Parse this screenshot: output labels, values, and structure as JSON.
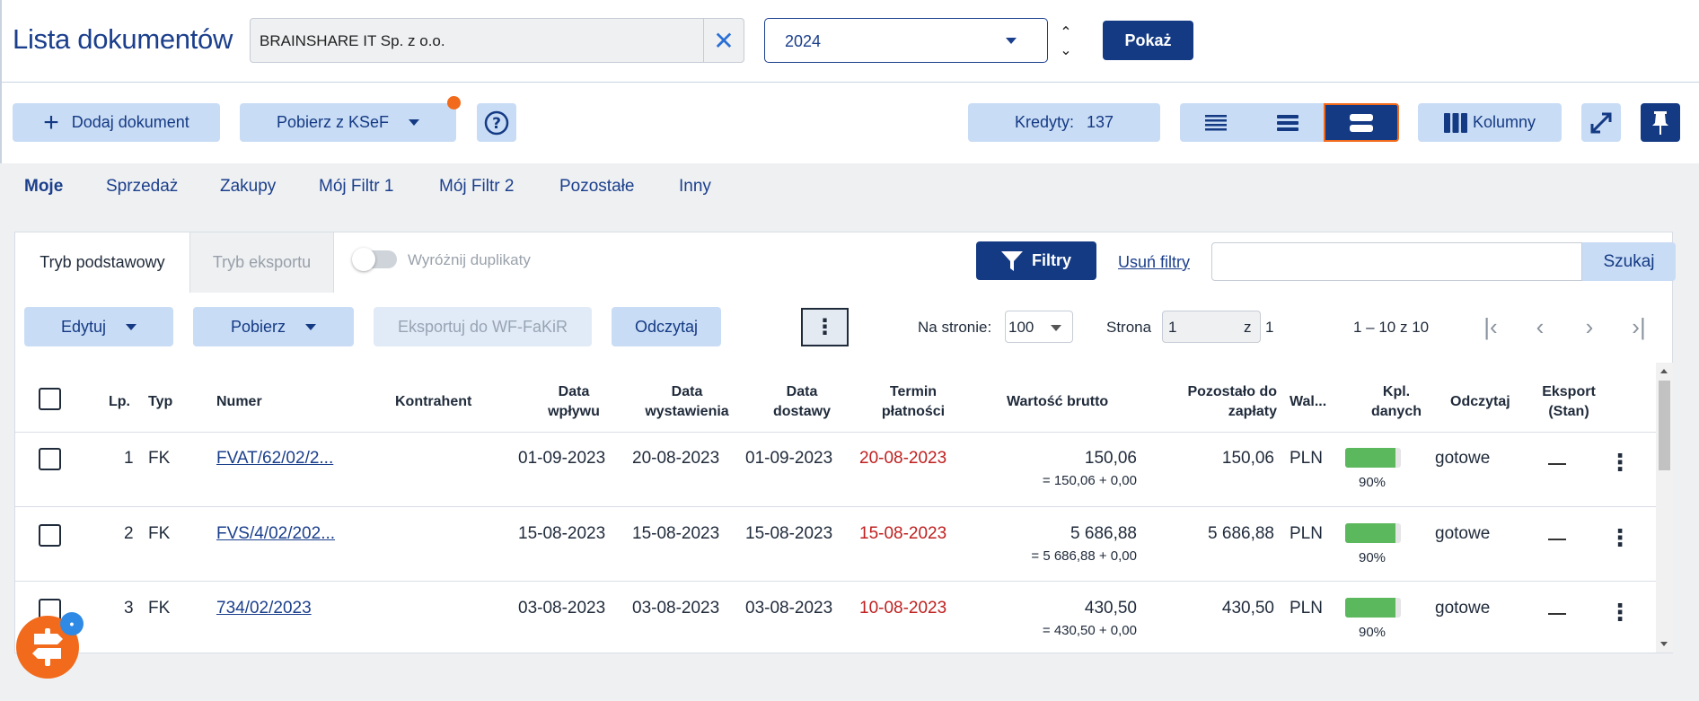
{
  "header": {
    "title": "Lista dokumentów",
    "company": "BRAINSHARE IT Sp. z o.o.",
    "year": "2024",
    "show_label": "Pokaż"
  },
  "toolbar": {
    "add_label": "Dodaj dokument",
    "ksef_label": "Pobierz z KSeF",
    "credits_label": "Kredyty:",
    "credits_value": "137",
    "columns_label": "Kolumny"
  },
  "filter_tabs": [
    "Moje",
    "Sprzedaż",
    "Zakupy",
    "Mój Filtr 1",
    "Mój Filtr 2",
    "Pozostałe",
    "Inny"
  ],
  "mode_tabs": {
    "basic": "Tryb podstawowy",
    "export": "Tryb eksportu",
    "duplicates_label": "Wyróżnij duplikaty"
  },
  "filters": {
    "filters_label": "Filtry",
    "clear_label": "Usuń filtry",
    "search_label": "Szukaj",
    "search_value": ""
  },
  "actions": {
    "edit_label": "Edytuj",
    "download_label": "Pobierz",
    "export_label": "Eksportuj do WF-FaKiR",
    "read_label": "Odczytaj"
  },
  "pager": {
    "per_page_label": "Na stronie:",
    "per_page_value": "100",
    "page_label": "Strona",
    "page_value": "1",
    "of_label": "z",
    "total_pages": "1",
    "range": "1 – 10 z 10"
  },
  "table": {
    "headers": {
      "lp": "Lp.",
      "typ": "Typ",
      "numer": "Numer",
      "kontrahent": "Kontrahent",
      "data_wplywu": [
        "Data",
        "wpływu"
      ],
      "data_wystawienia": [
        "Data",
        "wystawienia"
      ],
      "data_dostawy": [
        "Data",
        "dostawy"
      ],
      "termin": [
        "Termin",
        "płatności"
      ],
      "brutto": "Wartość brutto",
      "pozostalo": [
        "Pozostało do",
        "zapłaty"
      ],
      "waluta": "Wal...",
      "kpl": [
        "Kpl.",
        "danych"
      ],
      "odczytaj": "Odczytaj",
      "eksport": [
        "Eksport",
        "(Stan)"
      ]
    },
    "rows": [
      {
        "lp": "1",
        "typ": "FK",
        "numer": "FVAT/62/02/2...",
        "kontrahent": "",
        "data_wplywu": "01-09-2023",
        "data_wystawienia": "20-08-2023",
        "data_dostawy": "01-09-2023",
        "termin": "20-08-2023",
        "brutto": "150,06",
        "brutto_detail": "= 150,06 + 0,00",
        "pozostalo": "150,06",
        "waluta": "PLN",
        "kpl_pct": 90,
        "kpl_label": "90%",
        "odczytaj": "gotowe"
      },
      {
        "lp": "2",
        "typ": "FK",
        "numer": "FVS/4/02/202...",
        "kontrahent": "",
        "data_wplywu": "15-08-2023",
        "data_wystawienia": "15-08-2023",
        "data_dostawy": "15-08-2023",
        "termin": "15-08-2023",
        "brutto": "5 686,88",
        "brutto_detail": "= 5 686,88 + 0,00",
        "pozostalo": "5 686,88",
        "waluta": "PLN",
        "kpl_pct": 90,
        "kpl_label": "90%",
        "odczytaj": "gotowe"
      },
      {
        "lp": "3",
        "typ": "FK",
        "numer": "734/02/2023",
        "kontrahent": "",
        "data_wplywu": "03-08-2023",
        "data_wystawienia": "03-08-2023",
        "data_dostawy": "03-08-2023",
        "termin": "10-08-2023",
        "brutto": "430,50",
        "brutto_detail": "= 430,50 + 0,00",
        "pozostalo": "430,50",
        "waluta": "PLN",
        "kpl_pct": 90,
        "kpl_label": "90%",
        "odczytaj": "gotowe"
      }
    ]
  },
  "colors": {
    "primary": "#143a84",
    "accent_light": "#c9dcf5",
    "overdue": "#c01f1f",
    "progress": "#5cb85c",
    "fab": "#f26a1b"
  },
  "icons": {
    "clear": "close-icon",
    "add": "plus-icon",
    "help": "question-icon",
    "density_compact": "list-compact-icon",
    "density_normal": "list-normal-icon",
    "density_comfortable": "list-comfortable-icon",
    "columns": "columns-icon",
    "expand": "expand-icon",
    "pin": "pin-icon",
    "filter": "filter-icon",
    "fab": "signpost-icon"
  }
}
